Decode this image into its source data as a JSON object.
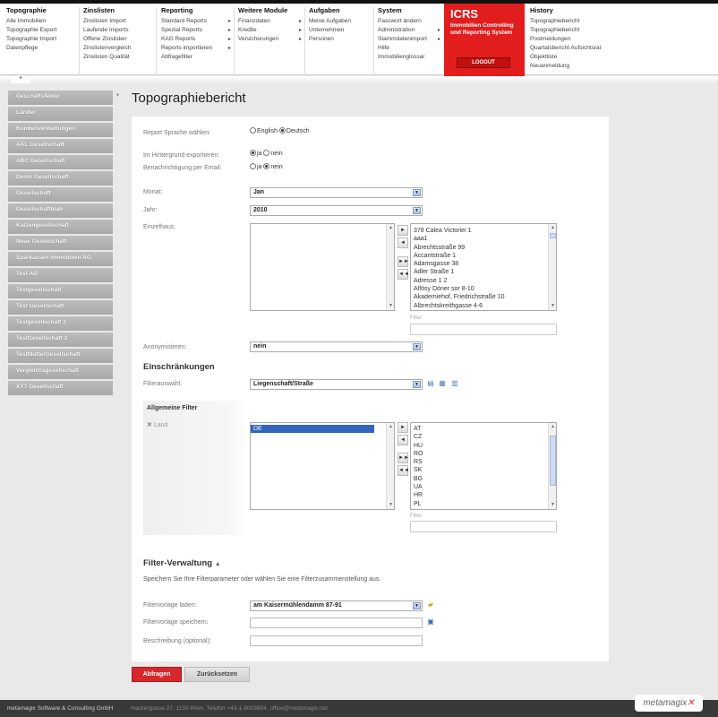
{
  "menu": {
    "topographie": {
      "header": "Topographie",
      "items": [
        "Alle Immobilien",
        "Topographie Export",
        "Topographie Import",
        "Datenpflege"
      ]
    },
    "zinslisten": {
      "header": "Zinslisten",
      "items": [
        "Zinslisten Import",
        "Laufende Imports",
        "Offene Zinslisten",
        "Zinslistenvergleich",
        "Zinslisten Qualität"
      ]
    },
    "reporting": {
      "header": "Reporting",
      "items": [
        "Standard Reports",
        "Spezial Reports",
        "KAG Reports",
        "Reports importieren",
        "Abfragefilter"
      ]
    },
    "weitere": {
      "header": "Weitere Module",
      "items": [
        "Finanzdaten",
        "Kredite",
        "Versicherungen"
      ]
    },
    "aufgaben": {
      "header": "Aufgaben",
      "items": [
        "Meine Aufgaben",
        "Unternehmen",
        "Personen"
      ]
    },
    "system": {
      "header": "System",
      "items": [
        "Passwort ändern",
        "Administration",
        "Stammdatenimport",
        "Hilfe",
        "Immobilienglossar"
      ]
    },
    "icrs": {
      "title": "ICRS",
      "subtitle": "Immobilien Controlling und Reporting System",
      "logout": "LOGOUT"
    },
    "history": {
      "header": "History",
      "items": [
        "Topographiebericht",
        "Topographiebericht",
        "Postmeldungen",
        "Quartalsbericht Aufsichtsrat",
        "Objektliste",
        "Neuanmeldung"
      ]
    }
  },
  "sidebar": {
    "items": [
      "Geschäftsfelder",
      "Länder",
      "Kundenverwaltungen",
      "AAL Gesellschaft",
      "ABC Gesellschaft",
      "Demo Gesellschaft",
      "Gesellschaft",
      "Gesellschaftblah",
      "Katzengesellschaft",
      "Neue Gesellschaft",
      "Sparkassen Immobilien AG",
      "Test AG",
      "Testgesellschaft",
      "Test Gesellschaft",
      "Testgesellschaft 2",
      "TestGesellschaft 3",
      "TestMutterGesellschaft",
      "Vergleichsgesellschaft",
      "XY7 Gesellschaft"
    ],
    "star": "*"
  },
  "page": {
    "title": "Topographiebericht"
  },
  "form": {
    "sprache": {
      "label": "Report Sprache wählen:",
      "opt1": "English",
      "opt2": "Deutsch",
      "selected": "Deutsch"
    },
    "hintergrund": {
      "label": "Im Hintergrund exportieren:",
      "opt1": "ja",
      "opt2": "nein",
      "selected": "ja"
    },
    "email": {
      "label": "Benachrichtigung per Email:",
      "opt1": "ja",
      "opt2": "nein",
      "selected": "nein"
    },
    "monat": {
      "label": "Monat:",
      "value": "Jan"
    },
    "jahr": {
      "label": "Jahr:",
      "value": "2010"
    },
    "einzelhaus": {
      "label": "Einzelhaus:",
      "available": [
        "378 Calea Victoriei 1",
        "aaa1",
        "Abrechtsstraße 99",
        "Accantstraße 1",
        "Adamsgasse 38",
        "Adler Straße 1",
        "Adresse 1 2",
        "Alfösy Döner sor 8-10",
        "Akademiehof, Friedrichstraße 10",
        "Albrechtskreithgasse 4-6"
      ],
      "filter_label": "Filter"
    },
    "anonymisieren": {
      "label": "Anonymisieren:",
      "value": "nein"
    }
  },
  "einschraenkungen": {
    "title": "Einschränkungen",
    "filterauswahl": {
      "label": "Filterauswahl:",
      "value": "Liegenschaft/Straße"
    },
    "allgemeine_filter": "Allgemeine Filter",
    "land": {
      "label": "Land",
      "selected": [
        "DE"
      ],
      "available": [
        "AT",
        "CZ",
        "HU",
        "RO",
        "RS",
        "SK",
        "BG",
        "UA",
        "HR",
        "PL"
      ],
      "filter_label": "Filter"
    }
  },
  "filterverwaltung": {
    "title": "Filter-Verwaltung",
    "desc": "Speichern Sie Ihre Filterparameter oder wählen Sie eine Filterzusammenstellung aus.",
    "laden": {
      "label": "Filtervorlage laden:",
      "value": "am Kaisermühlendamm 87-91"
    },
    "speichern": {
      "label": "Filtervorlage speichern:",
      "value": ""
    },
    "beschreibung": {
      "label": "Beschreibung (optional):",
      "value": ""
    }
  },
  "buttons": {
    "abfragen": "Abfragen",
    "zuruecksetzen": "Zurücksetzen",
    "move_right": "►",
    "move_left": "◄",
    "move_all_right": "►►",
    "move_all_left": "◄◄"
  },
  "footer": {
    "company": "metamagix Software & Consulting GmbH",
    "address": "Hackergasse 27, 1150 Wien, Telefon +43-1-8003804, office@metamagix.net",
    "logo": "metamagix"
  }
}
